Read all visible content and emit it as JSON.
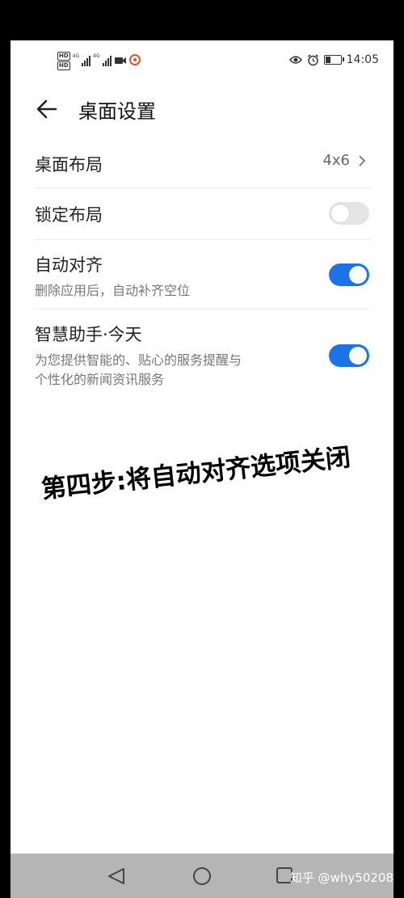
{
  "status_bar": {
    "left_badges": [
      "HD",
      "HD"
    ],
    "network": [
      "4G",
      "4G"
    ],
    "time": "14:05",
    "battery_level": 0.35,
    "icons": [
      "eye-icon",
      "alarm-icon",
      "battery-icon"
    ]
  },
  "header": {
    "title": "桌面设置"
  },
  "settings": {
    "layout": {
      "label": "桌面布局",
      "value": "4x6"
    },
    "lock": {
      "label": "锁定布局",
      "enabled": false
    },
    "auto_align": {
      "label": "自动对齐",
      "desc": "删除应用后，自动补齐空位",
      "enabled": true
    },
    "smart_assistant": {
      "label": "智慧助手·今天",
      "desc_line1": "为您提供智能的、贴心的服务提醒与",
      "desc_line2": "个性化的新闻资讯服务",
      "enabled": true
    }
  },
  "annotation": "第四步:将自动对齐选项关闭",
  "nav": {
    "icons": [
      "back-triangle-icon",
      "home-circle-icon",
      "recents-square-icon"
    ]
  },
  "watermark": "知乎 @why50208",
  "colors": {
    "toggle_on": "#1a73e8",
    "toggle_off": "#e4e4e4",
    "nav_bar": "#b5b5b5"
  }
}
